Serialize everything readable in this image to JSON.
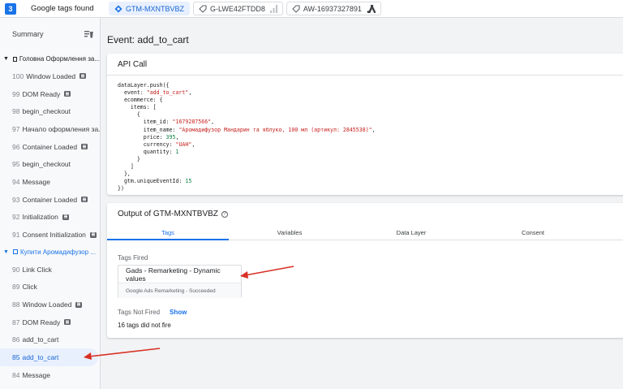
{
  "header": {
    "count_badge": "3",
    "title": "Google tags found",
    "tabs": [
      {
        "label": "GTM-MXNTBVBZ",
        "icon": "gtm-icon",
        "active": true
      },
      {
        "label": "G-LWE42FTDD8",
        "icon": "ga4-tag-icon",
        "tail_icon": "analytics-bars-icon"
      },
      {
        "label": "AW-16937327891",
        "icon": "ads-tag-icon",
        "tail_icon": "google-ads-icon"
      }
    ]
  },
  "sidebar": {
    "summary_label": "Summary",
    "groups": [
      {
        "label": "Головна Оформлення за...",
        "color": "#202124",
        "events": [
          {
            "num": "100",
            "label": "Window Loaded",
            "tag_icon": true
          },
          {
            "num": "99",
            "label": "DOM Ready",
            "tag_icon": true
          },
          {
            "num": "98",
            "label": "begin_checkout",
            "tag_icon": false
          },
          {
            "num": "97",
            "label": "Начало оформления за...",
            "tag_icon": false
          },
          {
            "num": "96",
            "label": "Container Loaded",
            "tag_icon": true
          },
          {
            "num": "95",
            "label": "begin_checkout",
            "tag_icon": false
          },
          {
            "num": "94",
            "label": "Message",
            "tag_icon": false
          },
          {
            "num": "93",
            "label": "Container Loaded",
            "tag_icon": true
          },
          {
            "num": "92",
            "label": "Initialization",
            "tag_icon": true
          },
          {
            "num": "91",
            "label": "Consent Initialization",
            "tag_icon": true
          }
        ]
      },
      {
        "label": "Купити Аромадифузор ...",
        "color": "#1a73e8",
        "events": [
          {
            "num": "90",
            "label": "Link Click",
            "tag_icon": false
          },
          {
            "num": "89",
            "label": "Click",
            "tag_icon": false
          },
          {
            "num": "88",
            "label": "Window Loaded",
            "tag_icon": true
          },
          {
            "num": "87",
            "label": "DOM Ready",
            "tag_icon": true
          },
          {
            "num": "86",
            "label": "add_to_cart",
            "tag_icon": false
          },
          {
            "num": "85",
            "label": "add_to_cart",
            "tag_icon": false,
            "selected": true
          },
          {
            "num": "84",
            "label": "Message",
            "tag_icon": false
          }
        ]
      }
    ]
  },
  "main": {
    "event_title": "Event: add_to_cart",
    "api_call": {
      "title": "API Call",
      "lines": [
        [
          [
            "",
            "dataLayer.push({"
          ]
        ],
        [
          [
            "",
            "  event: "
          ],
          [
            "s",
            "\"add_to_cart\""
          ],
          [
            "",
            ","
          ]
        ],
        [
          [
            "",
            "  ecommerce: {"
          ]
        ],
        [
          [
            "",
            "    items: ["
          ]
        ],
        [
          [
            "",
            "      {"
          ]
        ],
        [
          [
            "",
            "        item_id: "
          ],
          [
            "s",
            "\"1679287566\""
          ],
          [
            "",
            ","
          ]
        ],
        [
          [
            "",
            "        item_name: "
          ],
          [
            "s",
            "\"Аромадифузор Мандарин та яблуко, 100 мл (артикул: 2845538)\""
          ],
          [
            "",
            ","
          ]
        ],
        [
          [
            "",
            "        price: "
          ],
          [
            "n",
            "395"
          ],
          [
            "",
            ","
          ]
        ],
        [
          [
            "",
            "        currency: "
          ],
          [
            "s",
            "\"UAH\""
          ],
          [
            "",
            ","
          ]
        ],
        [
          [
            "",
            "        quantity: "
          ],
          [
            "n",
            "1"
          ]
        ],
        [
          [
            "",
            "      }"
          ]
        ],
        [
          [
            "",
            "    ]"
          ]
        ],
        [
          [
            "",
            "  },"
          ]
        ],
        [
          [
            "",
            "  gtm.uniqueEventId: "
          ],
          [
            "n",
            "15"
          ]
        ],
        [
          [
            "",
            "})"
          ]
        ]
      ]
    },
    "output": {
      "title": "Output of GTM-MXNTBVBZ",
      "tabs": [
        "Tags",
        "Variables",
        "Data Layer",
        "Consent"
      ],
      "active_tab": "Tags",
      "tags_fired_label": "Tags Fired",
      "fired_tag_name": "Gads - Remarketing - Dynamic values",
      "fired_tag_status": "Google Ads Remarketing - Succeeded",
      "tags_not_fired_label": "Tags Not Fired",
      "show_label": "Show",
      "not_fired_count": "16 tags did not fire"
    }
  },
  "colors": {
    "accent": "#1a73e8",
    "annotation_arrow": "#d93025"
  }
}
